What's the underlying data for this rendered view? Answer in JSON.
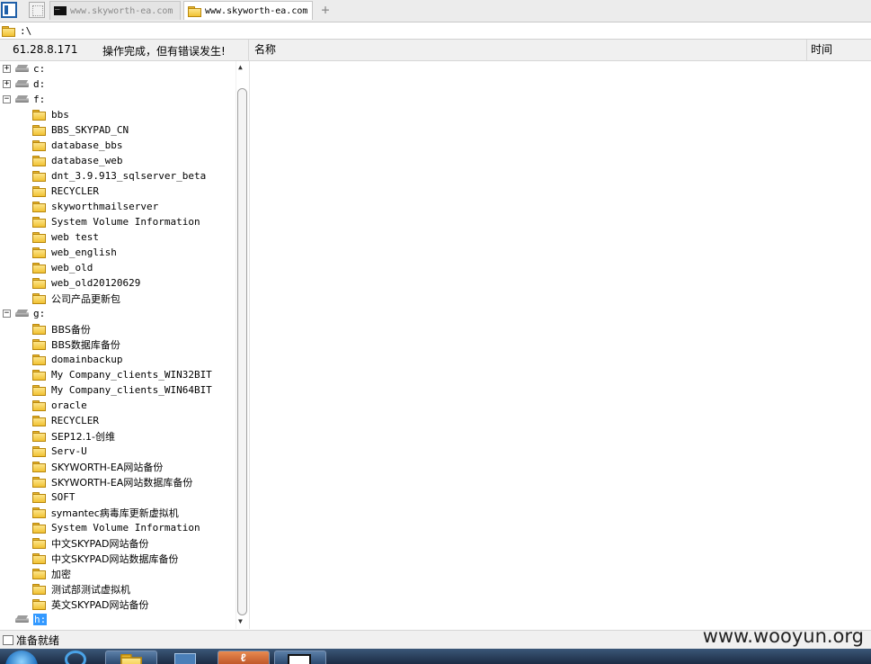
{
  "tabs": [
    {
      "label": "www.skyworth-ea.com",
      "active": false,
      "icon": "console-icon"
    },
    {
      "label": "www.skyworth-ea.com",
      "active": true,
      "icon": "folder-icon"
    }
  ],
  "path": {
    "value": ":\\"
  },
  "header": {
    "ip": "61.28.8.171",
    "status": "操作完成，但有错误发生!",
    "col_name": "名称",
    "col_time": "时间"
  },
  "tree": {
    "nodes": [
      {
        "label": "c:",
        "type": "drive",
        "expander": "+"
      },
      {
        "label": "d:",
        "type": "drive",
        "expander": "+"
      },
      {
        "label": "f:",
        "type": "drive",
        "expander": "-"
      },
      {
        "label": "bbs",
        "type": "folder"
      },
      {
        "label": "BBS_SKYPAD_CN",
        "type": "folder"
      },
      {
        "label": "database_bbs",
        "type": "folder"
      },
      {
        "label": "database_web",
        "type": "folder"
      },
      {
        "label": "dnt_3.9.913_sqlserver_beta",
        "type": "folder"
      },
      {
        "label": "RECYCLER",
        "type": "folder"
      },
      {
        "label": "skyworthmailserver",
        "type": "folder"
      },
      {
        "label": "System Volume Information",
        "type": "folder"
      },
      {
        "label": "web test",
        "type": "folder"
      },
      {
        "label": "web_english",
        "type": "folder"
      },
      {
        "label": "web_old",
        "type": "folder"
      },
      {
        "label": "web_old20120629",
        "type": "folder"
      },
      {
        "label": "公司产品更新包",
        "type": "folder"
      },
      {
        "label": "g:",
        "type": "drive",
        "expander": "-"
      },
      {
        "label": "BBS备份",
        "type": "folder"
      },
      {
        "label": "BBS数据库备份",
        "type": "folder"
      },
      {
        "label": "domainbackup",
        "type": "folder"
      },
      {
        "label": "My Company_clients_WIN32BIT",
        "type": "folder"
      },
      {
        "label": "My Company_clients_WIN64BIT",
        "type": "folder"
      },
      {
        "label": "oracle",
        "type": "folder"
      },
      {
        "label": "RECYCLER",
        "type": "folder"
      },
      {
        "label": "SEP12.1-创维",
        "type": "folder"
      },
      {
        "label": "Serv-U",
        "type": "folder"
      },
      {
        "label": "SKYWORTH-EA网站备份",
        "type": "folder"
      },
      {
        "label": "SKYWORTH-EA网站数据库备份",
        "type": "folder"
      },
      {
        "label": "SOFT",
        "type": "folder"
      },
      {
        "label": "symantec病毒库更新虚拟机",
        "type": "folder"
      },
      {
        "label": "System Volume Information",
        "type": "folder"
      },
      {
        "label": "中文SKYPAD网站备份",
        "type": "folder"
      },
      {
        "label": "中文SKYPAD网站数据库备份",
        "type": "folder"
      },
      {
        "label": "加密",
        "type": "folder"
      },
      {
        "label": "测试部测试虚拟机",
        "type": "folder"
      },
      {
        "label": "英文SKYPAD网站备份",
        "type": "folder"
      },
      {
        "label": "h:",
        "type": "drive",
        "selected": true
      }
    ]
  },
  "statusbar": {
    "text": "准备就绪",
    "watermark": "www.wooyun.org"
  },
  "colors": {
    "selection": "#3399ff",
    "folder": "#f1c232",
    "taskbar": "#1c2c44"
  }
}
